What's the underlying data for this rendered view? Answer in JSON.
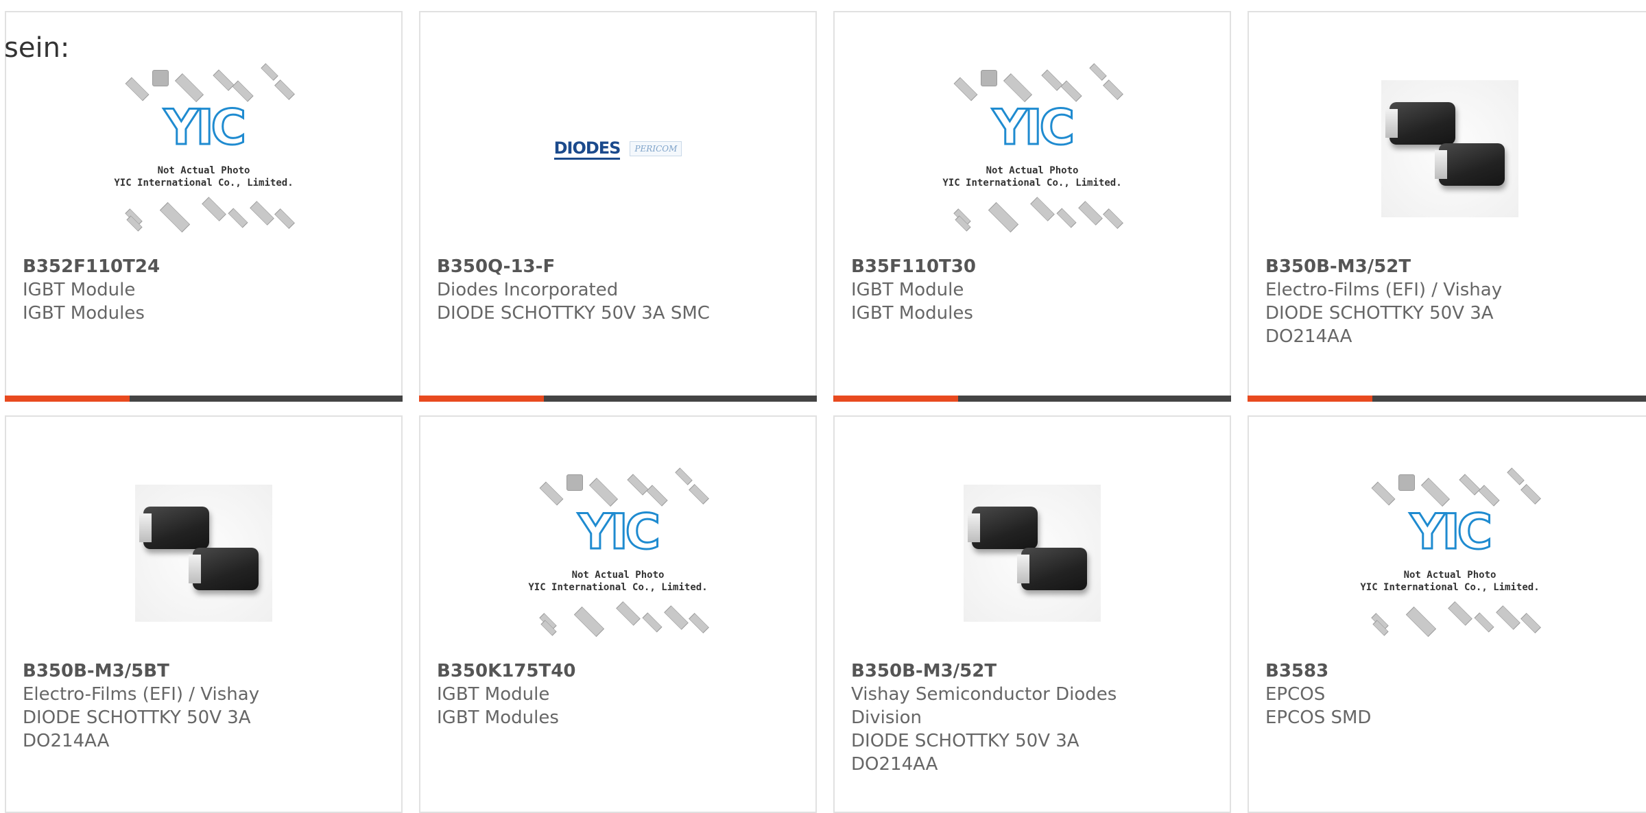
{
  "intro_text": "sein:",
  "colors": {
    "accent": "#e84a1f",
    "bar": "#444444",
    "border": "#e1e1e1",
    "text": "#666666"
  },
  "placeholder": {
    "logo_text": "YIC",
    "caption_line1": "Not Actual Photo",
    "caption_line2": "YIC International Co., Limited."
  },
  "diodes_logo": {
    "brand": "DIODES",
    "sub": "PERICOM"
  },
  "products": [
    {
      "part_no": "B352F110T24",
      "lines": [
        "IGBT Module",
        "IGBT Modules"
      ],
      "image": "yic-placeholder"
    },
    {
      "part_no": "B350Q-13-F",
      "lines": [
        "Diodes Incorporated",
        "DIODE SCHOTTKY 50V 3A SMC"
      ],
      "image": "diodes-logo"
    },
    {
      "part_no": "B35F110T30",
      "lines": [
        "IGBT Module",
        "IGBT Modules"
      ],
      "image": "yic-placeholder"
    },
    {
      "part_no": "B350B-M3/52T",
      "lines": [
        "Electro-Films (EFI) / Vishay",
        "DIODE SCHOTTKY 50V 3A",
        "DO214AA"
      ],
      "image": "smc-package"
    },
    {
      "part_no": "B350B-M3/5BT",
      "lines": [
        "Electro-Films (EFI) / Vishay",
        "DIODE SCHOTTKY 50V 3A",
        "DO214AA"
      ],
      "image": "smc-package"
    },
    {
      "part_no": "B350K175T40",
      "lines": [
        "IGBT Module",
        "IGBT Modules"
      ],
      "image": "yic-placeholder"
    },
    {
      "part_no": "B350B-M3/52T",
      "lines": [
        "Vishay Semiconductor Diodes",
        "Division",
        "DIODE SCHOTTKY 50V 3A",
        "DO214AA"
      ],
      "image": "smc-package"
    },
    {
      "part_no": "B3583",
      "lines": [
        "EPCOS",
        "EPCOS SMD"
      ],
      "image": "yic-placeholder"
    }
  ]
}
